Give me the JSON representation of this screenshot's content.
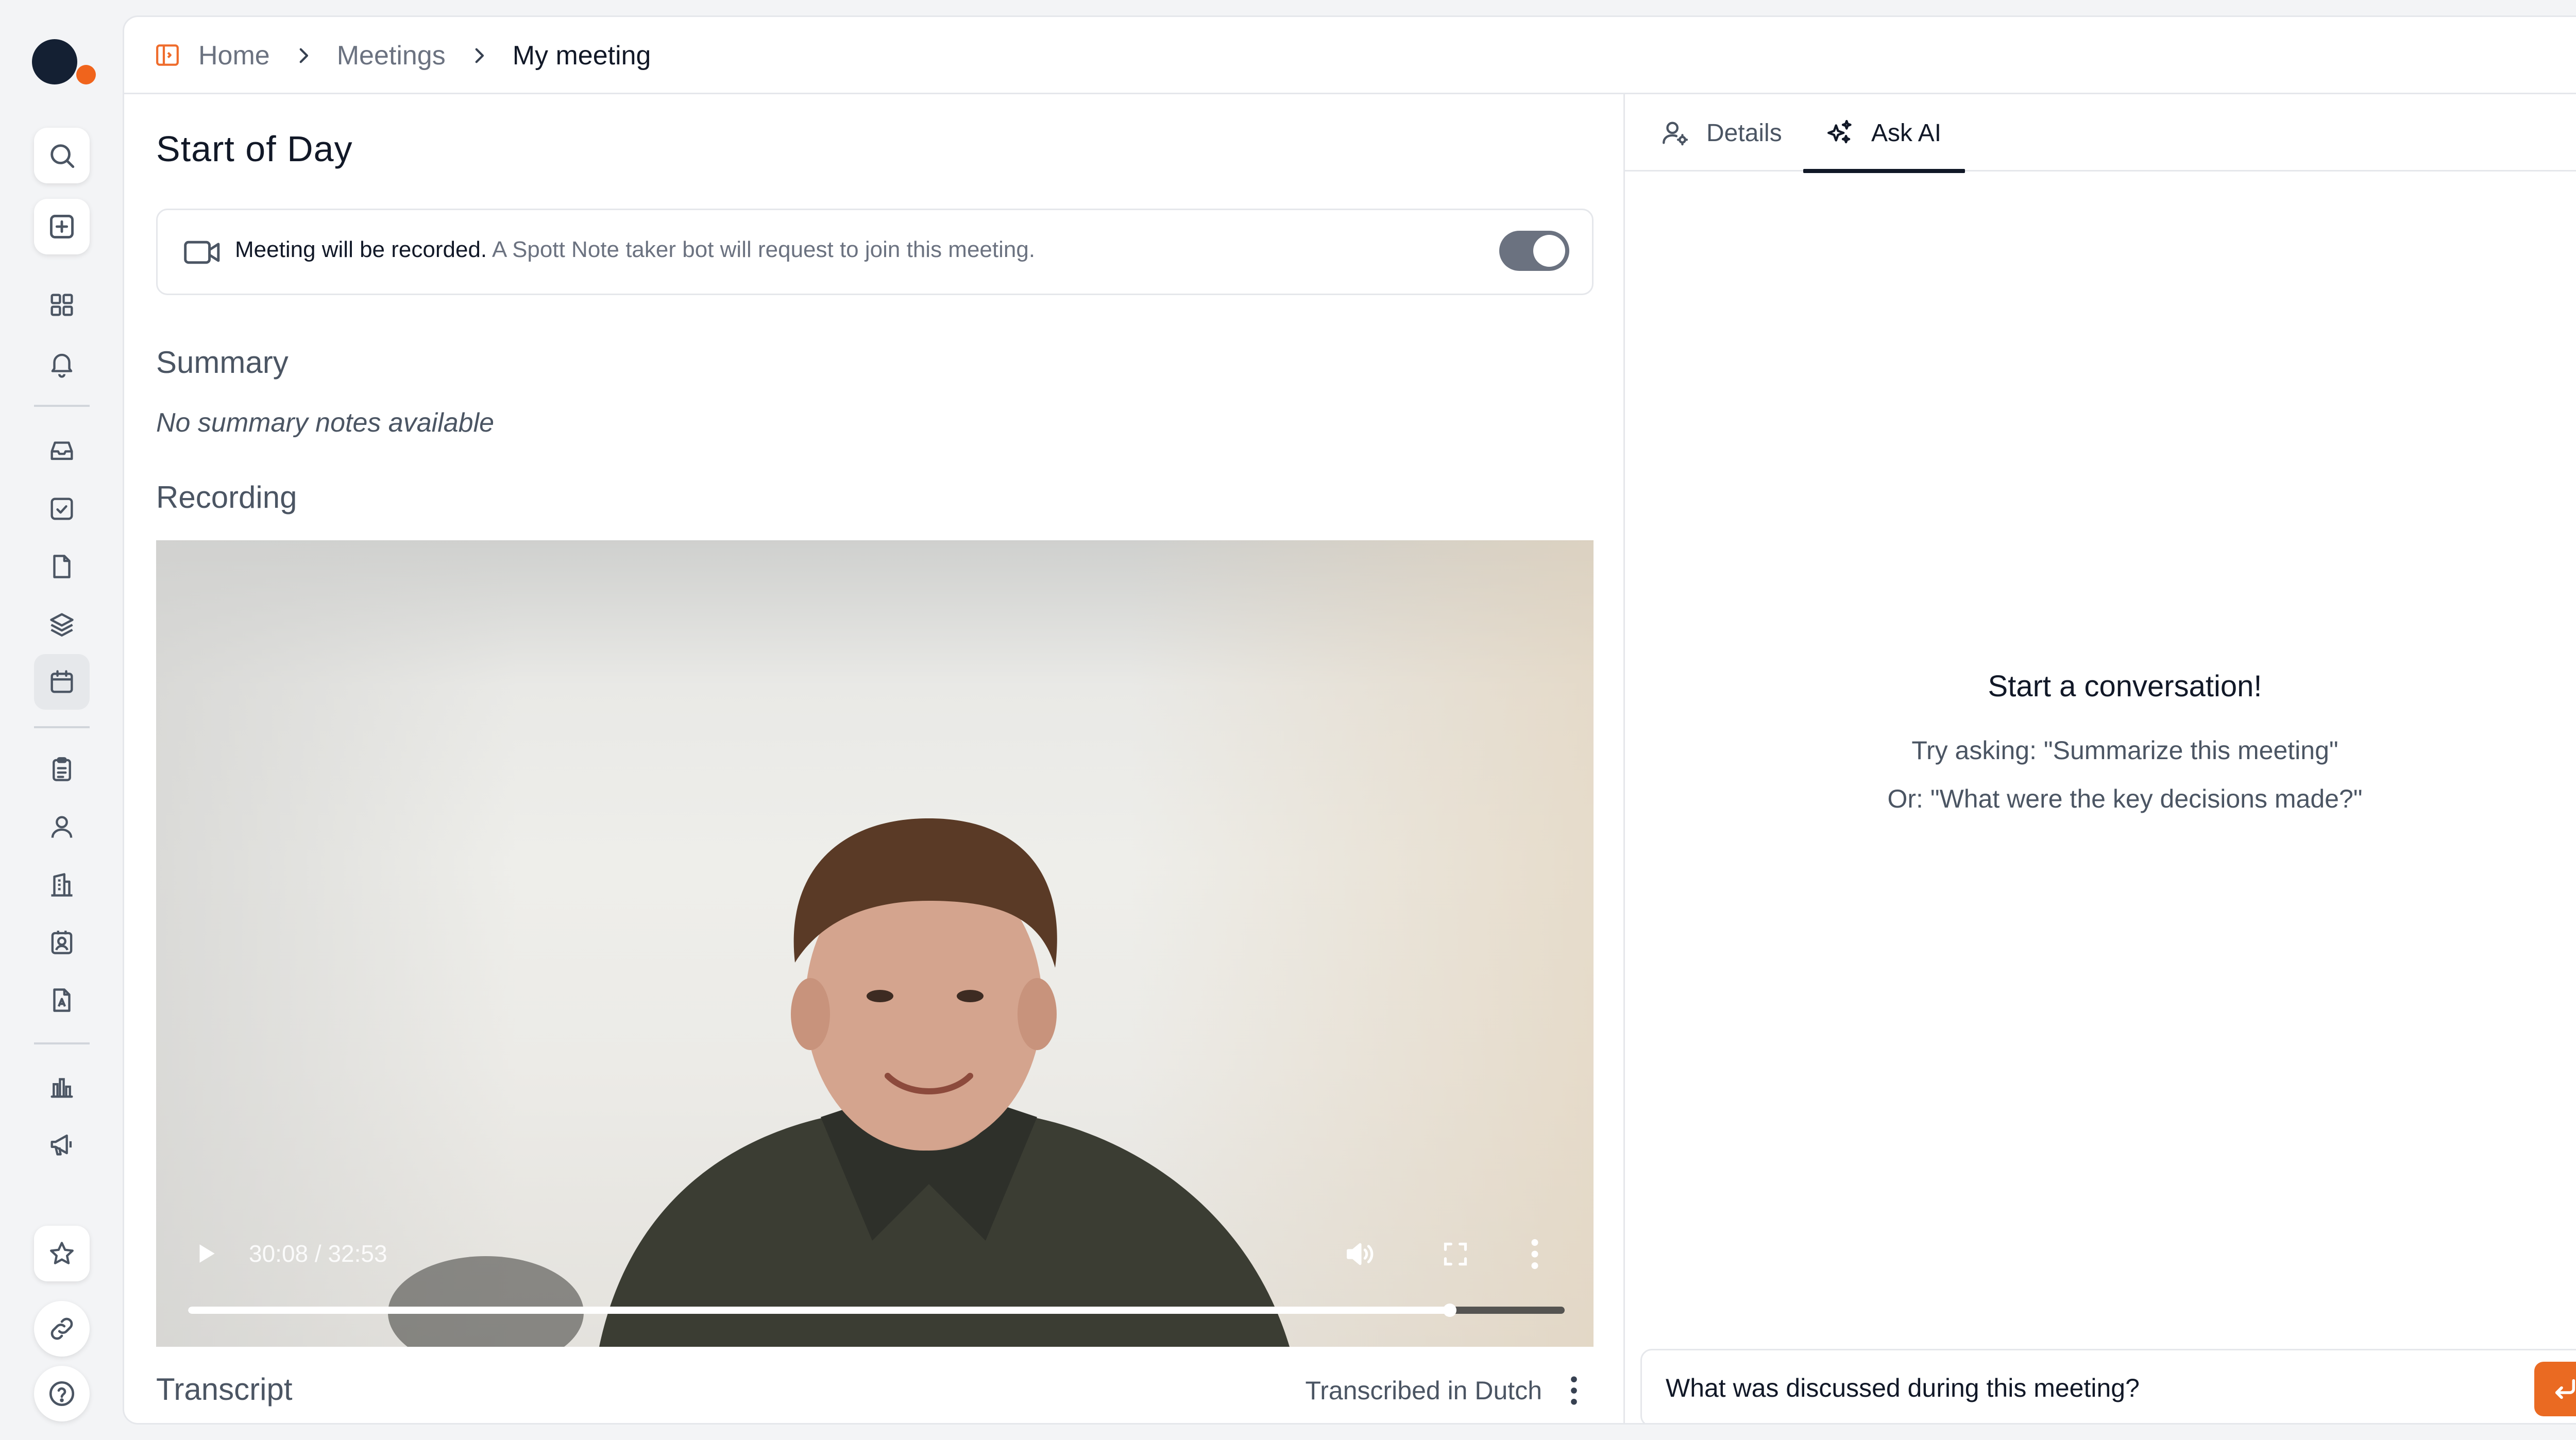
{
  "breadcrumbs": {
    "home": "Home",
    "meetings": "Meetings",
    "current": "My meeting"
  },
  "meeting": {
    "title": "Start of Day",
    "recording_notice_bold": "Meeting will be recorded.",
    "recording_notice_rest": "A Spott Note taker bot will request to join this meeting.",
    "recording_enabled": true
  },
  "summary": {
    "label": "Summary",
    "empty_text": "No summary notes available"
  },
  "recording": {
    "label": "Recording",
    "current_time": "30:08",
    "duration": "32:53",
    "time_display": "30:08 / 32:53",
    "progress": 0.9164
  },
  "transcript": {
    "label": "Transcript",
    "language_text": "Transcribed in Dutch"
  },
  "right_panel": {
    "tabs": [
      {
        "label": "Details",
        "icon": "user-gear-icon",
        "active": false
      },
      {
        "label": "Ask AI",
        "icon": "sparkles-icon",
        "active": true
      }
    ],
    "empty_title": "Start a conversation!",
    "hint_1": "Try asking: \"Summarize this meeting\"",
    "hint_2": "Or: \"What were the key decisions made?\"",
    "input_value": "What was discussed during this meeting?"
  },
  "colors": {
    "accent": "#ea6a22",
    "logo_dark": "#142033",
    "logo_accent": "#f0641c"
  }
}
